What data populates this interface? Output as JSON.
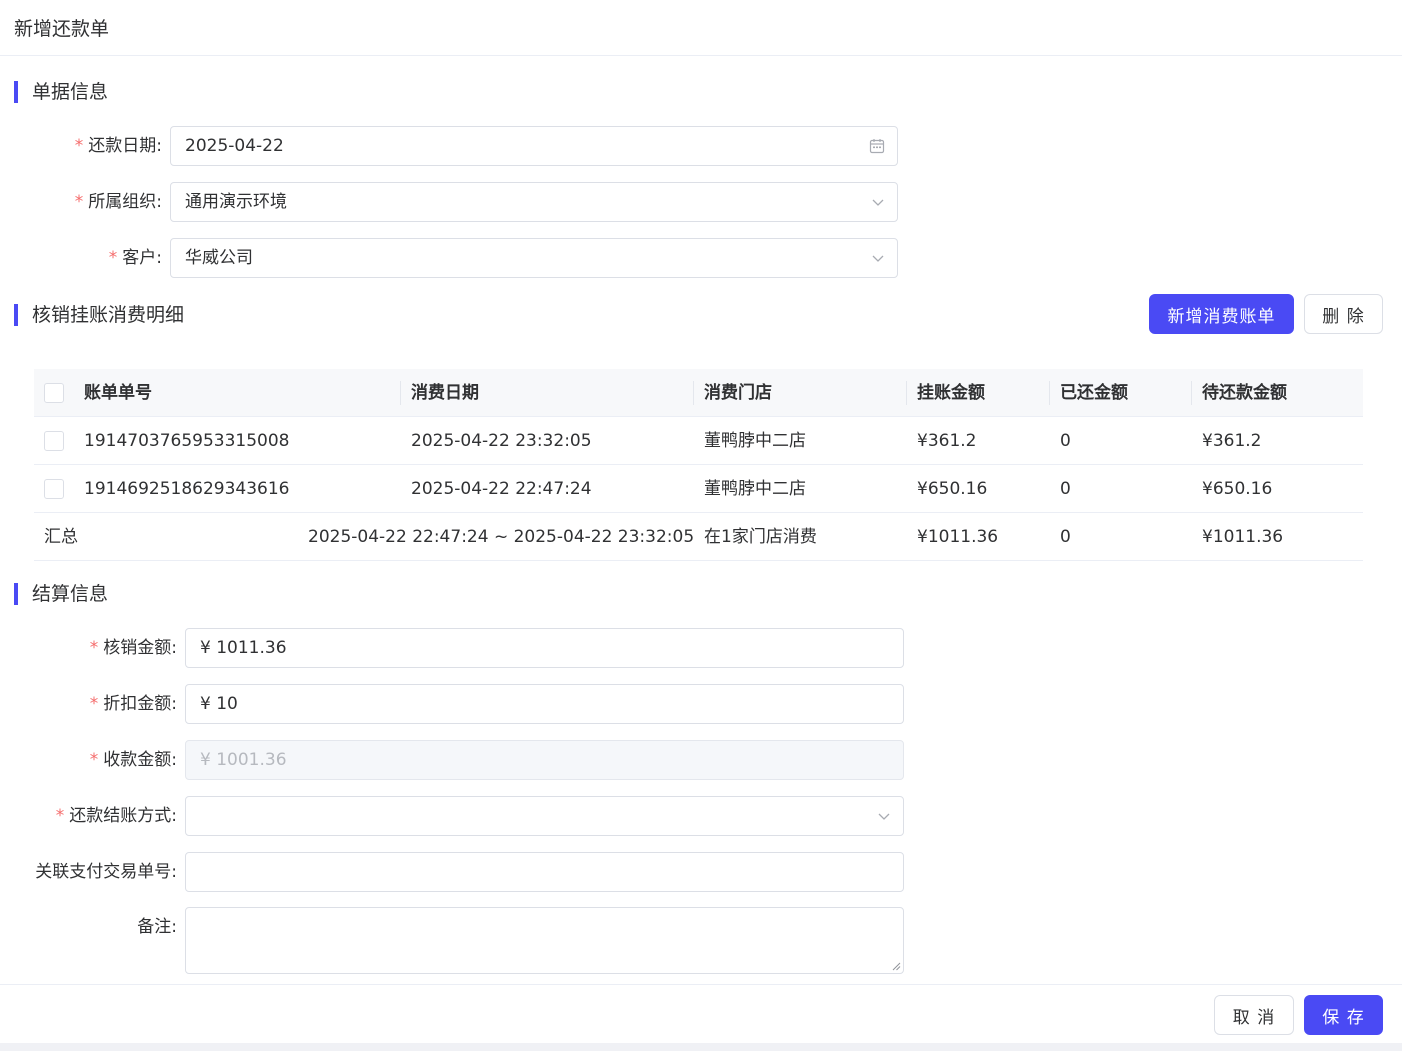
{
  "dialog": {
    "title": "新增还款单"
  },
  "section_doc": {
    "title": "单据信息"
  },
  "doc_form": {
    "repay_date": {
      "label": "还款日期",
      "value": "2025-04-22"
    },
    "org": {
      "label": "所属组织",
      "value": "通用演示环境"
    },
    "customer": {
      "label": "客户",
      "value": "华威公司"
    }
  },
  "section_detail": {
    "title": "核销挂账消费明细"
  },
  "detail_actions": {
    "add_label": "新增消费账单",
    "delete_label": "删 除"
  },
  "table": {
    "headers": [
      "账单单号",
      "消费日期",
      "消费门店",
      "挂账金额",
      "已还金额",
      "待还款金额"
    ],
    "rows": [
      [
        "1914703765953315008",
        "2025-04-22 23:32:05",
        "董鸭脖中二店",
        "¥361.2",
        "0",
        "¥361.2"
      ],
      [
        "1914692518629343616",
        "2025-04-22 22:47:24",
        "董鸭脖中二店",
        "¥650.16",
        "0",
        "¥650.16"
      ]
    ],
    "summary": {
      "label": "汇总",
      "date_range": "2025-04-22 22:47:24 ~ 2025-04-22 23:32:05",
      "stores": "在1家门店消费",
      "charge": "¥1011.36",
      "paid": "0",
      "pending": "¥1011.36"
    }
  },
  "section_settle": {
    "title": "结算信息"
  },
  "settle_form": {
    "writeoff": {
      "label": "核销金额",
      "value": "¥ 1011.36"
    },
    "discount": {
      "label": "折扣金额",
      "value": "¥ 10"
    },
    "receive": {
      "label": "收款金额",
      "value": "¥ 1001.36"
    },
    "pay_method": {
      "label": "还款结账方式",
      "value": ""
    },
    "trade_no": {
      "label": "关联支付交易单号",
      "value": ""
    },
    "remark": {
      "label": "备注",
      "value": ""
    }
  },
  "footer": {
    "cancel_label": "取 消",
    "save_label": "保 存"
  },
  "colors": {
    "accent": "#4a4af4",
    "required": "#f56c6c"
  }
}
